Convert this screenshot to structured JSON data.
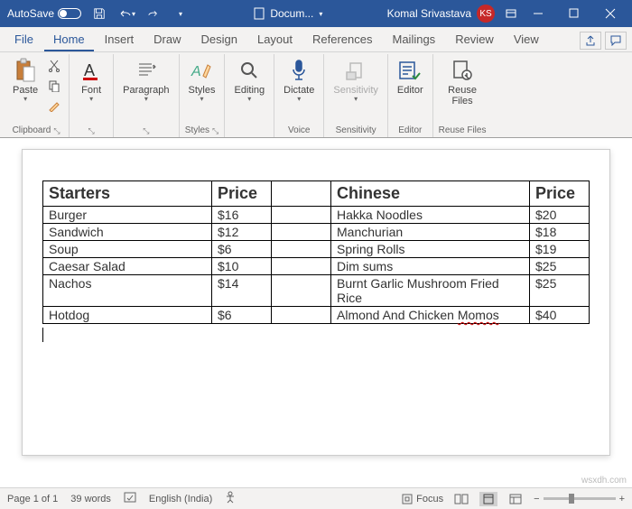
{
  "titlebar": {
    "autosave_label": "AutoSave",
    "doc_name": "Docum...",
    "user_name": "Komal Srivastava",
    "user_initials": "KS"
  },
  "tabs": {
    "file": "File",
    "home": "Home",
    "insert": "Insert",
    "draw": "Draw",
    "design": "Design",
    "layout": "Layout",
    "references": "References",
    "mailings": "Mailings",
    "review": "Review",
    "view": "View"
  },
  "ribbon": {
    "clipboard": {
      "paste": "Paste",
      "label": "Clipboard"
    },
    "font": {
      "btn": "Font"
    },
    "paragraph": {
      "btn": "Paragraph"
    },
    "styles": {
      "btn": "Styles",
      "label": "Styles"
    },
    "editing": {
      "btn": "Editing"
    },
    "voice": {
      "btn": "Dictate",
      "label": "Voice"
    },
    "sensitivity": {
      "btn": "Sensitivity",
      "label": "Sensitivity"
    },
    "editor": {
      "btn": "Editor",
      "label": "Editor"
    },
    "reuse": {
      "line1": "Reuse",
      "line2": "Files",
      "label": "Reuse Files"
    }
  },
  "table": {
    "headers": {
      "c1": "Starters",
      "c2": "Price",
      "c3": "Chinese",
      "c4": "Price"
    },
    "rows": [
      {
        "a": "Burger",
        "ap": "$16",
        "b": "Hakka Noodles",
        "bp": "$20"
      },
      {
        "a": "Sandwich",
        "ap": "$12",
        "b": "Manchurian",
        "bp": "$18"
      },
      {
        "a": "Soup",
        "ap": "$6",
        "b": "Spring Rolls",
        "bp": "$19"
      },
      {
        "a": "Caesar Salad",
        "ap": "$10",
        "b": "Dim sums",
        "bp": "$25"
      },
      {
        "a": "Nachos",
        "ap": "$14",
        "b": "Burnt Garlic Mushroom Fried Rice",
        "bp": "$25"
      },
      {
        "a": "Hotdog",
        "ap": "$6",
        "b": "Almond And Chicken ",
        "b2": "Momos",
        "bp": "$40"
      }
    ]
  },
  "status": {
    "page": "Page 1 of 1",
    "words": "39 words",
    "lang": "English (India)",
    "focus": "Focus"
  },
  "watermark": "wsxdh.com"
}
